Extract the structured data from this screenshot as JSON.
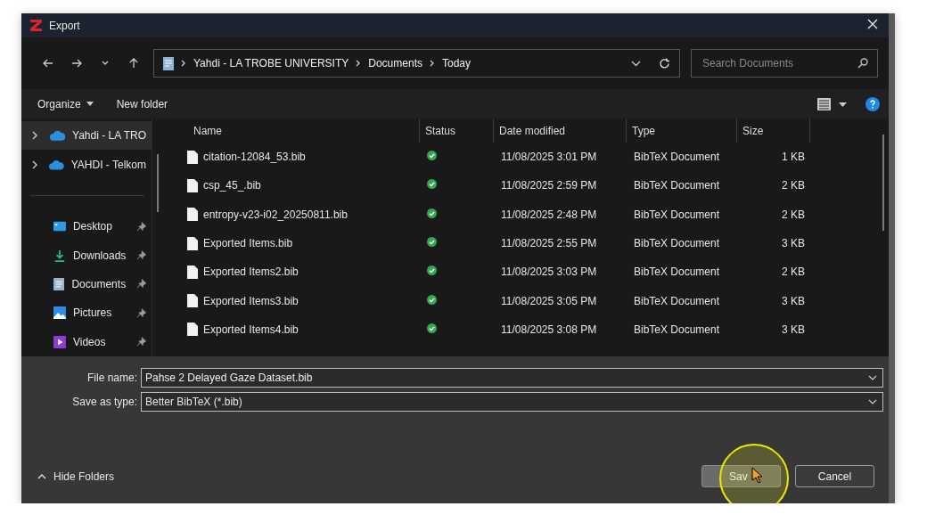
{
  "window": {
    "title": "Export"
  },
  "address_bar": {
    "path": [
      "Yahdi - LA TROBE UNIVERSITY",
      "Documents",
      "Today"
    ]
  },
  "search": {
    "placeholder": "Search Documents"
  },
  "toolbar": {
    "organize": "Organize",
    "new_folder": "New folder"
  },
  "sidebar": {
    "items": [
      {
        "label": "Yahdi - LA TRO",
        "kind": "cloud",
        "selected": true
      },
      {
        "label": "YAHDI - Telkom",
        "kind": "cloud",
        "selected": false
      },
      {
        "label": "Desktop",
        "kind": "desktop",
        "selected": false
      },
      {
        "label": "Downloads",
        "kind": "downloads",
        "selected": false
      },
      {
        "label": "Documents",
        "kind": "documents",
        "selected": false
      },
      {
        "label": "Pictures",
        "kind": "pictures",
        "selected": false
      },
      {
        "label": "Videos",
        "kind": "videos",
        "selected": false
      }
    ]
  },
  "table": {
    "columns": [
      "Name",
      "Status",
      "Date modified",
      "Type",
      "Size"
    ],
    "rows": [
      {
        "name": "citation-12084_53.bib",
        "synced": true,
        "date": "11/08/2025 3:01 PM",
        "type": "BibTeX Document",
        "size": "1 KB"
      },
      {
        "name": "csp_45_.bib",
        "synced": true,
        "date": "11/08/2025 2:59 PM",
        "type": "BibTeX Document",
        "size": "2 KB"
      },
      {
        "name": "entropy-v23-i02_20250811.bib",
        "synced": true,
        "date": "11/08/2025 2:48 PM",
        "type": "BibTeX Document",
        "size": "2 KB"
      },
      {
        "name": "Exported Items.bib",
        "synced": true,
        "date": "11/08/2025 2:55 PM",
        "type": "BibTeX Document",
        "size": "3 KB"
      },
      {
        "name": "Exported Items2.bib",
        "synced": true,
        "date": "11/08/2025 3:03 PM",
        "type": "BibTeX Document",
        "size": "2 KB"
      },
      {
        "name": "Exported Items3.bib",
        "synced": true,
        "date": "11/08/2025 3:05 PM",
        "type": "BibTeX Document",
        "size": "3 KB"
      },
      {
        "name": "Exported Items4.bib",
        "synced": true,
        "date": "11/08/2025 3:08 PM",
        "type": "BibTeX Document",
        "size": "3 KB"
      }
    ]
  },
  "form": {
    "file_name_label": "File name:",
    "file_name": "Pahse 2 Delayed Gaze Dataset.bib",
    "type_label": "Save as type:",
    "type_value": "Better BibTeX (*.bib)"
  },
  "footer": {
    "hide_folders": "Hide Folders",
    "buttons": [
      "Sav",
      "Cancel"
    ]
  }
}
